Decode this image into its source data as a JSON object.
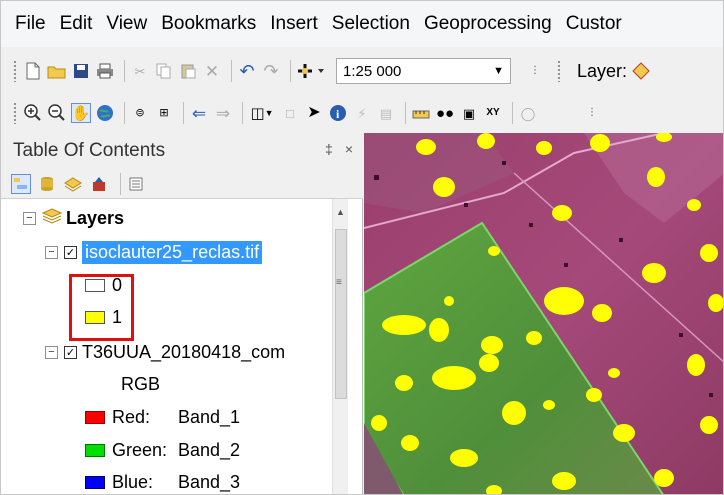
{
  "menu": [
    "File",
    "Edit",
    "View",
    "Bookmarks",
    "Insert",
    "Selection",
    "Geoprocessing",
    "Custor"
  ],
  "toolbar": {
    "scale_value": "1:25 000",
    "layer_label": "Layer:"
  },
  "toc": {
    "title": "Table Of Contents",
    "pin_glyph": "‡",
    "close_glyph": "×",
    "layers_group": "Layers",
    "layer1": {
      "name": "isoclauter25_reclas.tif",
      "classes": [
        {
          "label": "0",
          "color": "#ffffff"
        },
        {
          "label": "1",
          "color": "#ffff00"
        }
      ]
    },
    "layer2": {
      "name": "T36UUA_20180418_com",
      "render_type": "RGB",
      "bands": [
        {
          "label": "Red:",
          "band": "Band_1",
          "color": "#ff0000"
        },
        {
          "label": "Green:",
          "band": "Band_2",
          "color": "#00dd00"
        },
        {
          "label": "Blue:",
          "band": "Band_3",
          "color": "#0000ff"
        }
      ]
    }
  },
  "colors": {
    "selection": "#3399ff",
    "highlight_border": "#e01010",
    "map_field_magenta": "#a2406e",
    "map_field_green": "#5b9a3e",
    "map_class1": "#ffff00"
  }
}
